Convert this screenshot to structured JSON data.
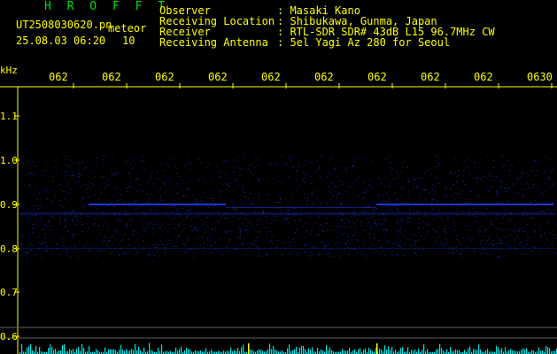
{
  "header": {
    "brand": "H R O F F T",
    "filename": "UT2508030620.pn",
    "timestamp": "25.08.03 06:20",
    "mode_label": "meteor",
    "count": "10",
    "info": [
      {
        "label": "Observer",
        "value": ": Masaki Kano"
      },
      {
        "label": "Receiving Location",
        "value": ": Shibukawa, Gunma, Japan"
      },
      {
        "label": "Receiver",
        "value": ": RTL-SDR SDR# 43dB L15 96.7MHz CW"
      },
      {
        "label": "Receiving Antenna",
        "value": ": 5el Yagi Az 280 for Seoul"
      }
    ]
  },
  "spectrogram": {
    "y_unit": "kHz",
    "x_ticks": [
      "062",
      "062",
      "062",
      "062",
      "062",
      "062",
      "062",
      "062",
      "062",
      "0630"
    ],
    "y_ticks": [
      "1.1",
      "1.0",
      "0.9",
      "0.8",
      "0.7",
      "0.6"
    ],
    "colors": {
      "background": "#000000",
      "text": "#ffff00",
      "brand": "#00e000",
      "grid": "#606060",
      "signal": "#2040ff",
      "meteor_trace": "#00ffff"
    }
  }
}
